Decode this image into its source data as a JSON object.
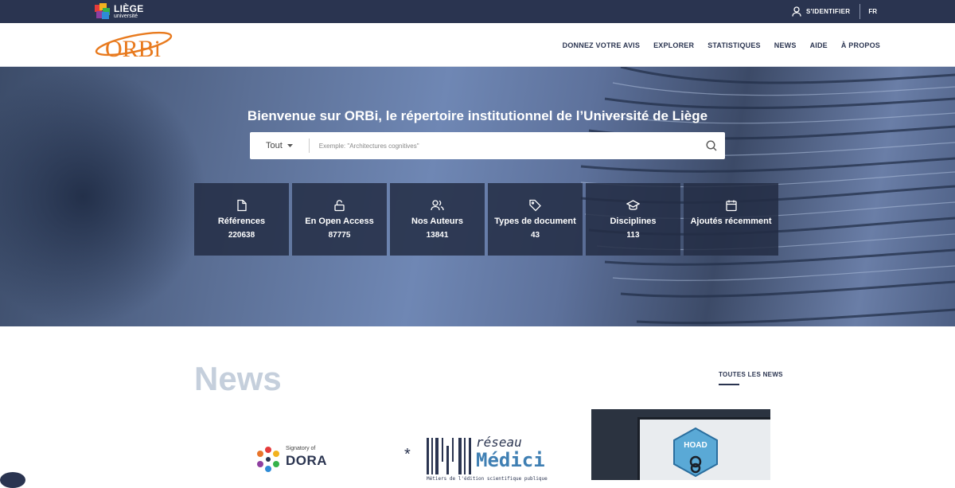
{
  "topbar": {
    "logo_line1": "LIÈGE",
    "logo_line2": "université",
    "signin_label": "S'IDENTIFIER",
    "lang_label": "FR"
  },
  "header": {
    "logo_text": "ORBi",
    "nav": [
      "DONNEZ VOTRE AVIS",
      "EXPLORER",
      "STATISTIQUES",
      "NEWS",
      "AIDE",
      "À PROPOS"
    ]
  },
  "hero": {
    "title": "Bienvenue sur ORBi, le répertoire institutionnel de l’Université de Liège",
    "search_scope": "Tout",
    "search_placeholder": "Exemple: \"Architectures cognitives\""
  },
  "tiles": [
    {
      "icon": "document-icon",
      "label": "Références",
      "value": "220638"
    },
    {
      "icon": "lock-open-icon",
      "label": "En Open Access",
      "value": "87775"
    },
    {
      "icon": "users-icon",
      "label": "Nos Auteurs",
      "value": "13841"
    },
    {
      "icon": "tag-icon",
      "label": "Types de document",
      "value": "43"
    },
    {
      "icon": "graduation-cap-icon",
      "label": "Disciplines",
      "value": "113"
    },
    {
      "icon": "calendar-icon",
      "label": "Ajoutés récemment",
      "value": ""
    }
  ],
  "news": {
    "heading": "News",
    "all_link": "TOUTES LES NEWS",
    "dora_signatory": "Signatory of",
    "dora_name": "DORA",
    "medici_reseau": "réseau",
    "medici_name": "Médici",
    "medici_sub": "Métiers de l'édition scientifique publique",
    "hoad_label": "HOAD"
  },
  "colors": {
    "navy": "#2a3450",
    "orbi_orange": "#e87a1e",
    "tile_bg": "#232d44",
    "news_heading": "#c5cfdc"
  }
}
